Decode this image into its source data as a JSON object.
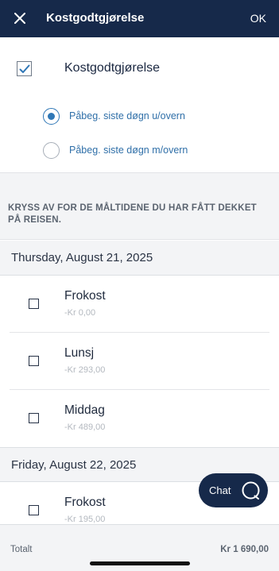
{
  "header": {
    "title": "Kostgodtgjørelse",
    "ok_label": "OK",
    "close_icon": "close-icon"
  },
  "main_option": {
    "label": "Kostgodtgjørelse",
    "checked": true
  },
  "radio_options": [
    {
      "label": "Påbeg. siste døgn u/overn",
      "selected": true
    },
    {
      "label": "Påbeg. siste døgn m/overn",
      "selected": false
    }
  ],
  "instruction": "KRYSS AV FOR DE MÅLTIDENE DU HAR FÅTT DEKKET PÅ REISEN.",
  "days": [
    {
      "date": "Thursday, August 21, 2025",
      "meals": [
        {
          "name": "Frokost",
          "price": "-Kr 0,00",
          "checked": false
        },
        {
          "name": "Lunsj",
          "price": "-Kr 293,00",
          "checked": false
        },
        {
          "name": "Middag",
          "price": "-Kr 489,00",
          "checked": false
        }
      ]
    },
    {
      "date": "Friday, August 22, 2025",
      "meals": [
        {
          "name": "Frokost",
          "price": "-Kr 195,00",
          "checked": false
        }
      ]
    }
  ],
  "chat": {
    "label": "Chat",
    "icon": "chat-bubble-icon"
  },
  "footer": {
    "label": "Totalt",
    "total": "Kr 1 690,00"
  },
  "colors": {
    "header_bg": "#16294a",
    "accent": "#2f77b6",
    "link_text": "#2f6fa8"
  }
}
